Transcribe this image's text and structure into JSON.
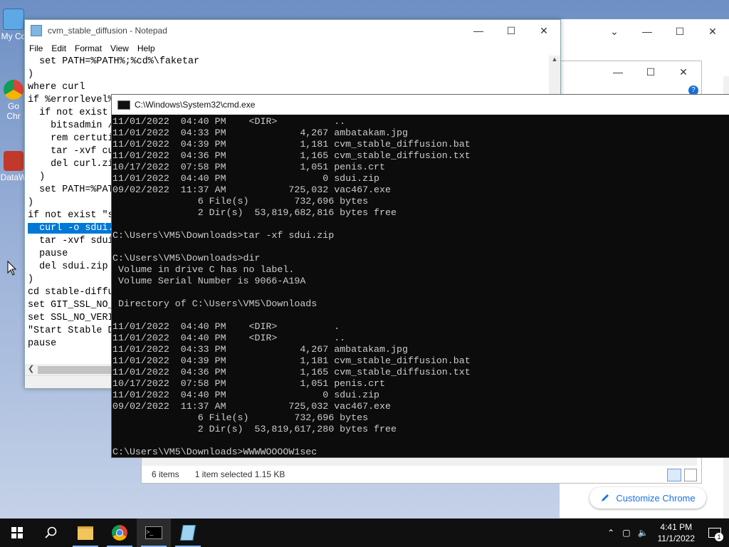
{
  "desktop": {
    "icons": [
      {
        "label": "My Co",
        "icon": "computer-icon"
      },
      {
        "label": "Go Chr",
        "icon": "chrome-icon"
      },
      {
        "label": "DataW",
        "icon": "app-icon"
      }
    ]
  },
  "notepad": {
    "title": "cvm_stable_diffusion - Notepad",
    "menu": [
      "File",
      "Edit",
      "Format",
      "View",
      "Help"
    ],
    "lines": [
      "  set PATH=%PATH%;%cd%\\faketar",
      ")",
      "where curl",
      "if %errorlevel%",
      "  if not exist",
      "    bitsadmin /",
      "    rem certuti",
      "    tar -xvf cu",
      "    del curl.zi",
      "  )",
      "  set PATH=%PAT",
      ")",
      "if not exist \"s",
      "  curl -o sdui.",
      "  tar -xvf sdui",
      "  pause",
      "  del sdui.zip",
      ")",
      "cd stable-diffu",
      "set GIT_SSL_NO_",
      "set SSL_NO_VERI",
      "\"Start Stable D",
      "pause"
    ],
    "selected_line_index": 13
  },
  "explorer": {
    "status_items": "6 items",
    "status_selected": "1 item selected  1.15 KB"
  },
  "cmd": {
    "title": "C:\\Windows\\System32\\cmd.exe",
    "lines": [
      "11/01/2022  04:40 PM    <DIR>          ..",
      "11/01/2022  04:33 PM             4,267 ambatakam.jpg",
      "11/01/2022  04:39 PM             1,181 cvm_stable_diffusion.bat",
      "11/01/2022  04:36 PM             1,165 cvm_stable_diffusion.txt",
      "10/17/2022  07:58 PM             1,051 penis.crt",
      "11/01/2022  04:40 PM                 0 sdui.zip",
      "09/02/2022  11:37 AM           725,032 vac467.exe",
      "               6 File(s)        732,696 bytes",
      "               2 Dir(s)  53,819,682,816 bytes free",
      "",
      "C:\\Users\\VM5\\Downloads>tar -xf sdui.zip",
      "",
      "C:\\Users\\VM5\\Downloads>dir",
      " Volume in drive C has no label.",
      " Volume Serial Number is 9066-A19A",
      "",
      " Directory of C:\\Users\\VM5\\Downloads",
      "",
      "11/01/2022  04:40 PM    <DIR>          .",
      "11/01/2022  04:40 PM    <DIR>          ..",
      "11/01/2022  04:33 PM             4,267 ambatakam.jpg",
      "11/01/2022  04:39 PM             1,181 cvm_stable_diffusion.bat",
      "11/01/2022  04:36 PM             1,165 cvm_stable_diffusion.txt",
      "10/17/2022  07:58 PM             1,051 penis.crt",
      "11/01/2022  04:40 PM                 0 sdui.zip",
      "09/02/2022  11:37 AM           725,032 vac467.exe",
      "               6 File(s)        732,696 bytes",
      "               2 Dir(s)  53,819,617,280 bytes free",
      "",
      "C:\\Users\\VM5\\Downloads>WWWWOOOOW1sec"
    ]
  },
  "chrome": {
    "customize_label": "Customize Chrome"
  },
  "taskbar": {
    "time": "4:41 PM",
    "date": "11/1/2022",
    "notification_count": "1"
  },
  "colors": {
    "accent": "#0078d7",
    "cmd_bg": "#0c0c0c",
    "cmd_text": "#cccccc",
    "chrome_blue": "#1a73e8"
  }
}
